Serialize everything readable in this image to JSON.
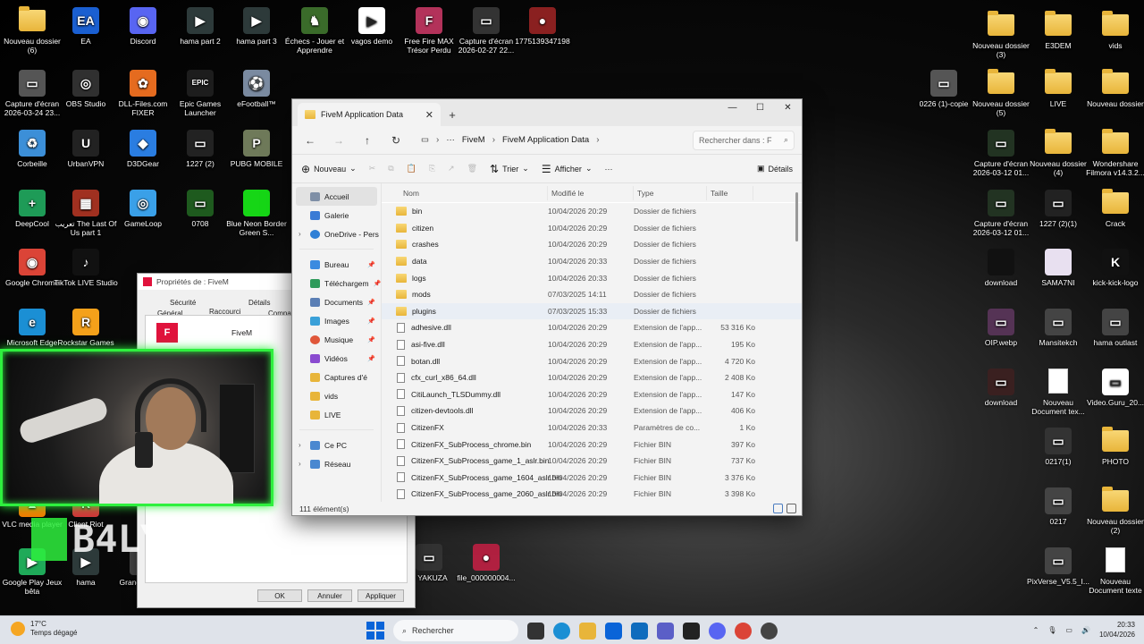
{
  "desktop_icons": [
    {
      "label": "Nouveau dossier (6)",
      "type": "folder",
      "color": "#f0c24b"
    },
    {
      "label": "EA",
      "type": "app",
      "color": "#1a5fd1",
      "glyph": "EA"
    },
    {
      "label": "Discord",
      "type": "app",
      "color": "#5865f2",
      "glyph": "◉"
    },
    {
      "label": "hama part 2",
      "type": "app",
      "color": "#2d3a3a",
      "glyph": "▶"
    },
    {
      "label": "hama part 3",
      "type": "app",
      "color": "#2d3a3a",
      "glyph": "▶"
    },
    {
      "label": "Échecs - Jouer et Apprendre",
      "type": "app",
      "color": "#3a6b2a",
      "glyph": "♞"
    },
    {
      "label": "vagos demo",
      "type": "app",
      "color": "#ffffff",
      "glyph": "▶"
    },
    {
      "label": "Free Fire MAX Trésor Perdu",
      "type": "app",
      "color": "#b3325a",
      "glyph": "F"
    },
    {
      "label": "Capture d'écran 2026-02-27 22...",
      "type": "app",
      "color": "#333333",
      "glyph": "▭"
    },
    {
      "label": "1775139347198",
      "type": "app",
      "color": "#8a2020",
      "glyph": "●"
    },
    {
      "label": "Capture d'écran 2026-03-24 23...",
      "type": "app",
      "color": "#555555",
      "glyph": "▭"
    },
    {
      "label": "OBS Studio",
      "type": "app",
      "color": "#303030",
      "glyph": "◎"
    },
    {
      "label": "DLL-Files.com FIXER",
      "type": "app",
      "color": "#e56b1f",
      "glyph": "✿"
    },
    {
      "label": "Epic Games Launcher",
      "type": "app",
      "color": "#1d1d1d",
      "glyph": "EPIC"
    },
    {
      "label": "eFootball™",
      "type": "app",
      "color": "#7a8aa0",
      "glyph": "⚽"
    },
    {
      "label": "Corbeille",
      "type": "app",
      "color": "#3c8fd8",
      "glyph": "♻"
    },
    {
      "label": "UrbanVPN",
      "type": "app",
      "color": "#222222",
      "glyph": "U"
    },
    {
      "label": "D3DGear",
      "type": "app",
      "color": "#2a7de1",
      "glyph": "◆"
    },
    {
      "label": "1227 (2)",
      "type": "app",
      "color": "#222222",
      "glyph": "▭"
    },
    {
      "label": "PUBG MOBILE",
      "type": "app",
      "color": "#6f7a5a",
      "glyph": "P"
    },
    {
      "label": "DeepCool",
      "type": "app",
      "color": "#1e9b57",
      "glyph": "+"
    },
    {
      "label": "تعريب The Last Of Us part 1",
      "type": "app",
      "color": "#a03020",
      "glyph": "▦"
    },
    {
      "label": "GameLoop",
      "type": "app",
      "color": "#3aa0e8",
      "glyph": "◎"
    },
    {
      "label": "0708",
      "type": "app",
      "color": "#1e5a1e",
      "glyph": "▭"
    },
    {
      "label": "Blue Neon Border Green S...",
      "type": "app",
      "color": "#16d616",
      "glyph": ""
    },
    {
      "label": "Google Chrome",
      "type": "app",
      "color": "#db4437",
      "glyph": "◉"
    },
    {
      "label": "TikTok LIVE Studio",
      "type": "app",
      "color": "#111111",
      "glyph": "♪"
    },
    {
      "label": "Microsoft Edge",
      "type": "app",
      "color": "#1b8fd4",
      "glyph": "e"
    },
    {
      "label": "Rockstar Games Launcher",
      "type": "app",
      "color": "#f4a11a",
      "glyph": "R"
    },
    {
      "label": "VLC media player",
      "type": "app",
      "color": "#f07c00",
      "glyph": "▲"
    },
    {
      "label": "Client Riot",
      "type": "app",
      "color": "#d13639",
      "glyph": "R"
    },
    {
      "label": "Google Play Jeux bêta",
      "type": "app",
      "color": "#1faa59",
      "glyph": "▶"
    },
    {
      "label": "hama",
      "type": "app",
      "color": "#2d3a3a",
      "glyph": "▶"
    },
    {
      "label": "Grand V Versi",
      "type": "app",
      "color": "#444444",
      "glyph": "V"
    },
    {
      "label": "Nouveau dossier (3)",
      "type": "folder",
      "color": "#f0c24b"
    },
    {
      "label": "E3DEM",
      "type": "folder",
      "color": "#f0c24b"
    },
    {
      "label": "vids",
      "type": "folder",
      "color": "#f0c24b"
    },
    {
      "label": "0226 (1)-copie",
      "type": "app",
      "color": "#555555",
      "glyph": "▭"
    },
    {
      "label": "Nouveau dossier (5)",
      "type": "folder",
      "color": "#f0c24b"
    },
    {
      "label": "LIVE",
      "type": "folder",
      "color": "#f0c24b"
    },
    {
      "label": "Nouveau dossier",
      "type": "folder",
      "color": "#f0c24b"
    },
    {
      "label": "Capture d'écran 2026-03-12 01...",
      "type": "app",
      "color": "#223322",
      "glyph": "▭"
    },
    {
      "label": "Nouveau dossier (4)",
      "type": "folder",
      "color": "#f0c24b"
    },
    {
      "label": "Wondershare Filmora v14.3.2...",
      "type": "folder",
      "color": "#f0c24b"
    },
    {
      "label": "Capture d'écran 2026-03-12 01...",
      "type": "app",
      "color": "#223322",
      "glyph": "▭"
    },
    {
      "label": "1227 (2)(1)",
      "type": "app",
      "color": "#222222",
      "glyph": "▭"
    },
    {
      "label": "Crack",
      "type": "folder",
      "color": "#f0c24b"
    },
    {
      "label": "download",
      "type": "app",
      "color": "#111111",
      "glyph": ""
    },
    {
      "label": "SAMA7NI",
      "type": "app",
      "color": "#e8e0f0",
      "glyph": ""
    },
    {
      "label": "kick-kick-logo",
      "type": "app",
      "color": "#111111",
      "glyph": "K"
    },
    {
      "label": "OIP.webp",
      "type": "app",
      "color": "#553355",
      "glyph": "▭"
    },
    {
      "label": "Mansitekch",
      "type": "app",
      "color": "#444444",
      "glyph": "▭"
    },
    {
      "label": "hama outlast",
      "type": "app",
      "color": "#444444",
      "glyph": "▭"
    },
    {
      "label": "download",
      "type": "app",
      "color": "#3a2020",
      "glyph": "▭"
    },
    {
      "label": "Nouveau Document tex...",
      "type": "doc",
      "color": "#ffffff"
    },
    {
      "label": "Video.Guru_20...",
      "type": "app",
      "color": "#ffffff",
      "glyph": "▭"
    },
    {
      "label": "0217(1)",
      "type": "app",
      "color": "#333333",
      "glyph": "▭"
    },
    {
      "label": "PHOTO",
      "type": "folder",
      "color": "#f0c24b"
    },
    {
      "label": "0217",
      "type": "app",
      "color": "#444444",
      "glyph": "▭"
    },
    {
      "label": "Nouveau dossier (2)",
      "type": "folder",
      "color": "#f0c24b"
    },
    {
      "label": "PixVerse_V5.5_I...",
      "type": "app",
      "color": "#444444",
      "glyph": "▭"
    },
    {
      "label": "Nouveau Document texte",
      "type": "doc",
      "color": "#ffffff"
    },
    {
      "label": "S YAKUZA",
      "type": "app",
      "color": "#333333",
      "glyph": "▭"
    },
    {
      "label": "file_000000004...",
      "type": "app",
      "color": "#b02040",
      "glyph": "●"
    }
  ],
  "explorer": {
    "tab_title": "FiveM Application Data",
    "tab_close": "✕",
    "new_tab": "+",
    "minimize": "—",
    "maximize": "☐",
    "close": "✕",
    "breadcrumb": [
      "FiveM",
      "FiveM Application Data"
    ],
    "breadcrumb_more": "···",
    "search_placeholder": "Rechercher dans : F",
    "commands": {
      "new": "Nouveau",
      "sort": "Trier",
      "view": "Afficher",
      "more": "···",
      "details": "Détails"
    },
    "nav": {
      "home": "Accueil",
      "gallery": "Galerie",
      "onedrive": "OneDrive - Pers",
      "desktop": "Bureau",
      "downloads": "Téléchargem",
      "documents": "Documents",
      "images": "Images",
      "music": "Musique",
      "videos": "Vidéos",
      "screenshots": "Captures d'é",
      "vids": "vids",
      "live": "LIVE",
      "this_pc": "Ce PC",
      "network": "Réseau"
    },
    "columns": {
      "name": "Nom",
      "modified": "Modifié le",
      "type": "Type",
      "size": "Taille"
    },
    "files": [
      {
        "name": "bin",
        "modified": "10/04/2026 20:29",
        "type": "Dossier de fichiers",
        "size": "",
        "kind": "folder"
      },
      {
        "name": "citizen",
        "modified": "10/04/2026 20:29",
        "type": "Dossier de fichiers",
        "size": "",
        "kind": "folder"
      },
      {
        "name": "crashes",
        "modified": "10/04/2026 20:29",
        "type": "Dossier de fichiers",
        "size": "",
        "kind": "folder"
      },
      {
        "name": "data",
        "modified": "10/04/2026 20:33",
        "type": "Dossier de fichiers",
        "size": "",
        "kind": "folder"
      },
      {
        "name": "logs",
        "modified": "10/04/2026 20:33",
        "type": "Dossier de fichiers",
        "size": "",
        "kind": "folder"
      },
      {
        "name": "mods",
        "modified": "07/03/2025 14:11",
        "type": "Dossier de fichiers",
        "size": "",
        "kind": "folder"
      },
      {
        "name": "plugins",
        "modified": "07/03/2025 15:33",
        "type": "Dossier de fichiers",
        "size": "",
        "kind": "folder"
      },
      {
        "name": "adhesive.dll",
        "modified": "10/04/2026 20:29",
        "type": "Extension de l'app...",
        "size": "53 316 Ko",
        "kind": "file"
      },
      {
        "name": "asi-five.dll",
        "modified": "10/04/2026 20:29",
        "type": "Extension de l'app...",
        "size": "195 Ko",
        "kind": "file"
      },
      {
        "name": "botan.dll",
        "modified": "10/04/2026 20:29",
        "type": "Extension de l'app...",
        "size": "4 720 Ko",
        "kind": "file"
      },
      {
        "name": "cfx_curl_x86_64.dll",
        "modified": "10/04/2026 20:29",
        "type": "Extension de l'app...",
        "size": "2 408 Ko",
        "kind": "file"
      },
      {
        "name": "CitiLaunch_TLSDummy.dll",
        "modified": "10/04/2026 20:29",
        "type": "Extension de l'app...",
        "size": "147 Ko",
        "kind": "file"
      },
      {
        "name": "citizen-devtools.dll",
        "modified": "10/04/2026 20:29",
        "type": "Extension de l'app...",
        "size": "406 Ko",
        "kind": "file"
      },
      {
        "name": "CitizenFX",
        "modified": "10/04/2026 20:33",
        "type": "Paramètres de co...",
        "size": "1 Ko",
        "kind": "file"
      },
      {
        "name": "CitizenFX_SubProcess_chrome.bin",
        "modified": "10/04/2026 20:29",
        "type": "Fichier BIN",
        "size": "397 Ko",
        "kind": "file"
      },
      {
        "name": "CitizenFX_SubProcess_game_1_aslr.bin",
        "modified": "10/04/2026 20:29",
        "type": "Fichier BIN",
        "size": "737 Ko",
        "kind": "file"
      },
      {
        "name": "CitizenFX_SubProcess_game_1604_aslr.bin",
        "modified": "10/04/2026 20:29",
        "type": "Fichier BIN",
        "size": "3 376 Ko",
        "kind": "file"
      },
      {
        "name": "CitizenFX_SubProcess_game_2060_aslr.bin",
        "modified": "10/04/2026 20:29",
        "type": "Fichier BIN",
        "size": "3 398 Ko",
        "kind": "file"
      }
    ],
    "status": "111 élément(s)"
  },
  "properties": {
    "title": "Propriétés de : FiveM",
    "tabs": {
      "security": "Sécurité",
      "details": "Détails",
      "general": "Général",
      "shortcut": "Raccourci",
      "compat": "Compati"
    },
    "app_name": "FiveM",
    "ok": "OK",
    "cancel": "Annuler",
    "apply": "Appliquer"
  },
  "overlay": {
    "logo_text": "B4LYY"
  },
  "taskbar": {
    "temp": "17°C",
    "weather": "Temps dégagé",
    "search": "Rechercher",
    "time": "20:33",
    "date": "10/04/2026"
  }
}
